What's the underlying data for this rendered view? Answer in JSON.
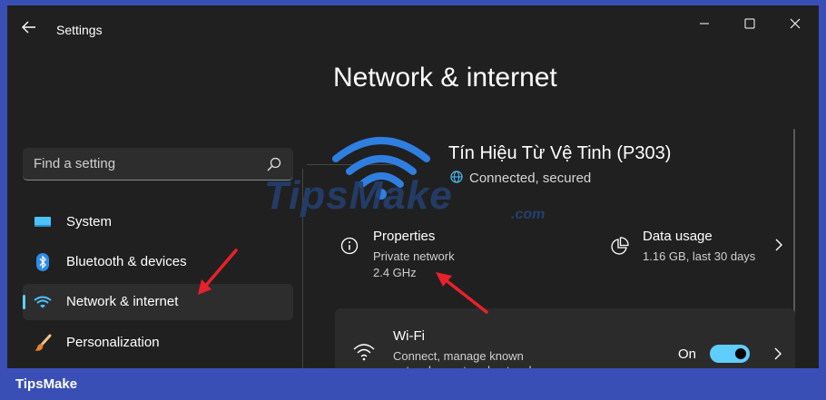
{
  "window": {
    "title": "Settings",
    "controls": {
      "minimize_icon": "minimize-icon",
      "maximize_icon": "maximize-icon",
      "close_icon": "close-icon"
    }
  },
  "search": {
    "placeholder": "Find a setting",
    "icon": "search-icon"
  },
  "sidebar": {
    "items": [
      {
        "label": "System",
        "icon": "display-icon",
        "selected": false
      },
      {
        "label": "Bluetooth & devices",
        "icon": "bluetooth-icon",
        "selected": false
      },
      {
        "label": "Network & internet",
        "icon": "wifi-icon",
        "selected": true
      },
      {
        "label": "Personalization",
        "icon": "brush-icon",
        "selected": false
      }
    ]
  },
  "main": {
    "page_title": "Network & internet",
    "network": {
      "name": "Tín Hiệu Từ Vệ Tinh (P303)",
      "status": "Connected, secured"
    },
    "properties": {
      "title": "Properties",
      "line1": "Private network",
      "line2": "2.4 GHz"
    },
    "data_usage": {
      "title": "Data usage",
      "subtitle": "1.16 GB, last 30 days"
    },
    "wifi_card": {
      "title": "Wi-Fi",
      "description": "Connect, manage known networks, metered network",
      "toggle_label": "On",
      "toggle_on": true
    }
  },
  "overlay": {
    "watermark": "TipsMake",
    "watermark_suffix": ".com",
    "brand": "TipsMake"
  },
  "colors": {
    "accent": "#60cdff",
    "window_bg": "#202020",
    "frame": "#3a4fb6",
    "annotation_arrow": "#e8212a"
  }
}
